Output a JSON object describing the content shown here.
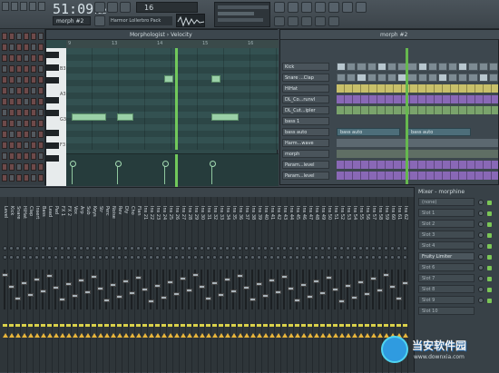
{
  "toolbar": {
    "time_main": "51:09",
    "time_sub": "22",
    "pattern": "morph #2",
    "hint_text": "Harmor Lollerbro Pack",
    "lcd_value": "16"
  },
  "piano_roll": {
    "title": "Morphologist › Velocity",
    "ruler": [
      "9",
      "13",
      "14",
      "15",
      "16"
    ],
    "key_labels": [
      "B3",
      "A3",
      "G3",
      "F3"
    ]
  },
  "channel_rack": {
    "title": "morph #2",
    "channels": [
      "Kick",
      "Snare ...Clap",
      "HiHat",
      "DL_Co...runvl",
      "DL_Cut...ipler",
      "bass 1",
      "bass auto",
      "Harm...wave",
      "morph",
      "Param...level",
      "Param...level",
      "Param...level"
    ],
    "auto_labels": [
      "bass auto",
      "bass auto"
    ]
  },
  "mixer": {
    "title": "Mixer - morphine",
    "strip_labels": [
      "Level",
      "Kick",
      "Snare",
      "HiHat",
      "Clap",
      "Insert",
      "Bass",
      "Lead",
      "Pad",
      "FX 1",
      "FX 2",
      "Vox",
      "Arp",
      "Sub",
      "Keys",
      "Str",
      "Perc",
      "Noise",
      "Rev",
      "Dly",
      "Cho",
      "Flan",
      "Ins 21",
      "Ins 22",
      "Ins 23",
      "Ins 24",
      "Ins 25",
      "Ins 26",
      "Ins 27",
      "Ins 28",
      "Ins 29",
      "Ins 30",
      "Ins 31",
      "Ins 32",
      "Ins 33",
      "Ins 34",
      "Ins 35",
      "Ins 36",
      "Ins 37",
      "Ins 38",
      "Ins 39",
      "Ins 40",
      "Ins 41",
      "Ins 42",
      "Ins 43",
      "Ins 44",
      "Ins 45",
      "Ins 46",
      "Ins 47",
      "Ins 48",
      "Ins 49",
      "Ins 50",
      "Ins 51",
      "Ins 52",
      "Ins 53",
      "Ins 54",
      "Ins 55",
      "Ins 56",
      "Ins 57",
      "Ins 58",
      "Ins 59",
      "Ins 60",
      "Ins 61",
      "Ins 62"
    ],
    "insert_title": "Mixer - morphine",
    "slots": [
      "(none)",
      "Slot 1",
      "Slot 2",
      "Slot 3",
      "Slot 4",
      "Fruity Limiter",
      "Slot 6",
      "Slot 7",
      "Slot 8",
      "Slot 9",
      "Slot 10"
    ]
  },
  "watermark": {
    "name": "当安软件园",
    "url": "www.downxia.com"
  }
}
